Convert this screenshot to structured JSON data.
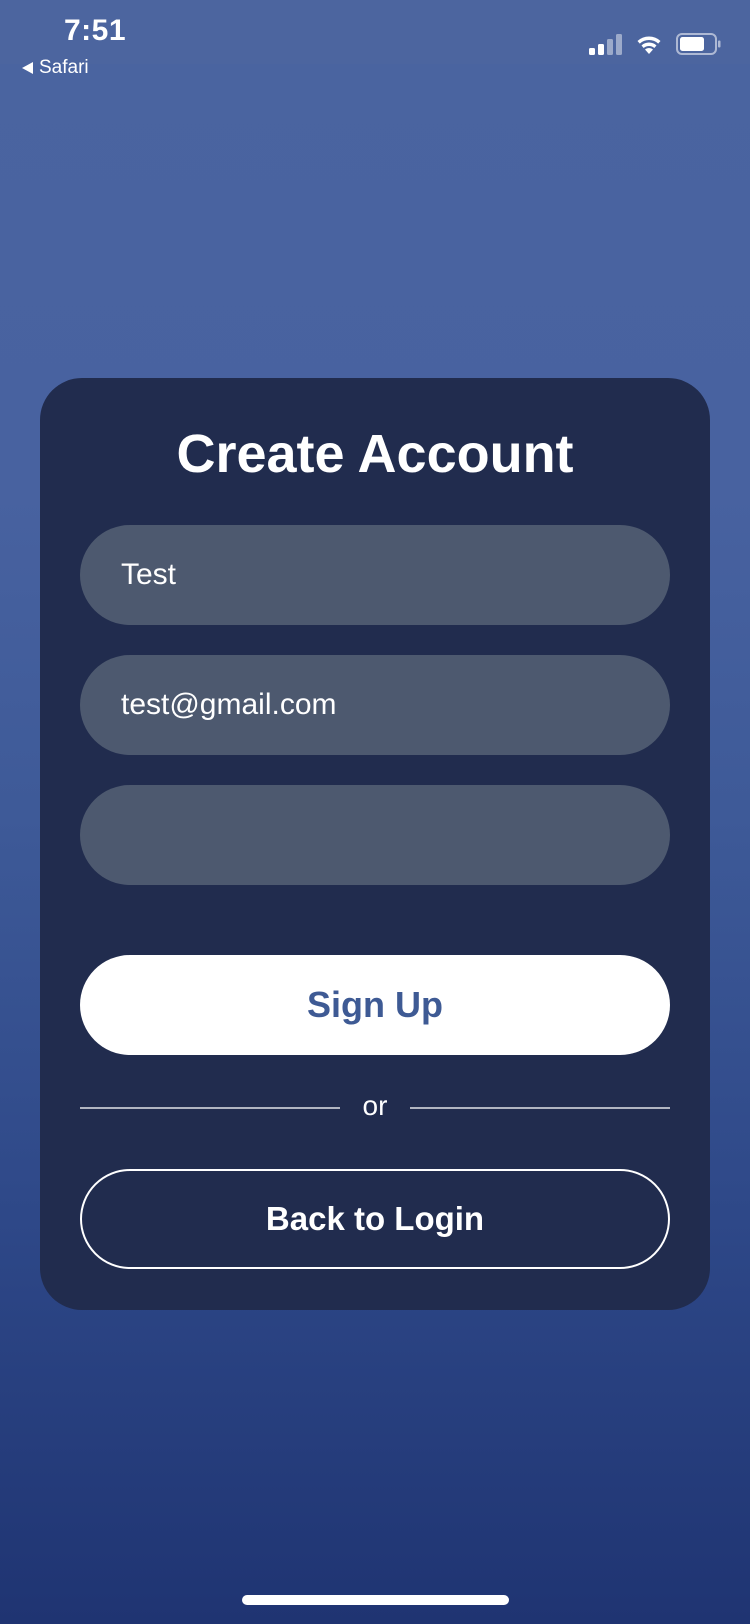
{
  "status_bar": {
    "time": "7:51",
    "back_app": "Safari",
    "signal_icon": "cellular-signal-icon",
    "wifi_icon": "wifi-icon",
    "battery_icon": "battery-icon"
  },
  "card": {
    "title": "Create Account",
    "name_value": "Test",
    "email_value": "test@gmail.com",
    "password_value": "",
    "signup_label": "Sign Up",
    "divider_text": "or",
    "back_login_label": "Back to Login"
  },
  "colors": {
    "background_top": "#4a64a0",
    "background_bottom": "#1f3472",
    "card": "#212c4e",
    "field": "#4d596f",
    "signup_text": "#3e5a94"
  }
}
